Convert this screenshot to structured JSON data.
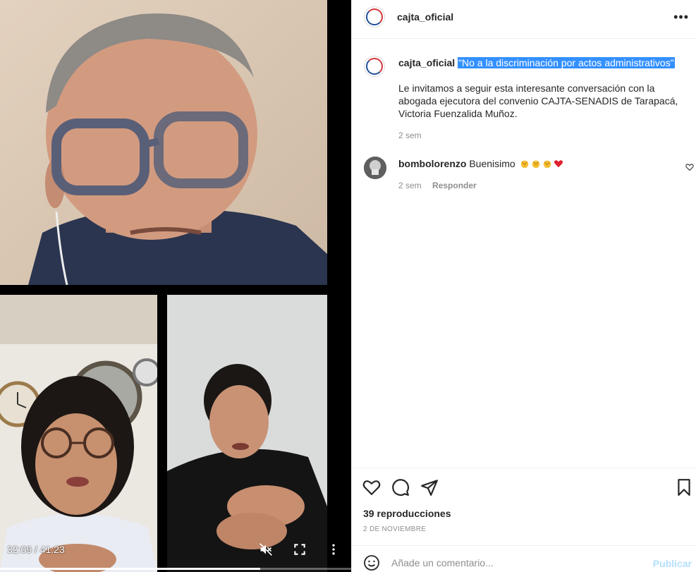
{
  "video": {
    "time_current": "32:09",
    "time_total": "41:23",
    "time_separator": " / ",
    "progress_fraction": 0.74
  },
  "header": {
    "username": "cajta_oficial",
    "more_icon": "more-horizontal-icon"
  },
  "caption": {
    "username": "cajta_oficial",
    "highlighted_text": "\"No a la discriminación por actos administrativos\"",
    "body": "Le invitamos a seguir esta interesante conversación con la abogada ejecutora del convenio CAJTA-SENADIS de Tarapacá, Victoria Fuenzalida Muñoz.",
    "time": "2 sem"
  },
  "comments": [
    {
      "username": "bombolorenzo",
      "text": "Buenisimo",
      "emojis": [
        "clapping-hands",
        "clapping-hands",
        "clapping-hands",
        "red-heart"
      ],
      "time": "2 sem",
      "reply_label": "Responder"
    }
  ],
  "actions": {
    "views": "39 reproducciones",
    "date": "2 DE NOVIEMBRE"
  },
  "add_comment": {
    "placeholder": "Añade un comentario...",
    "publish_label": "Publicar"
  },
  "colors": {
    "highlight": "#3390ff",
    "publish_disabled": "#b2dffc",
    "secondary_text": "#8e8e8e"
  }
}
